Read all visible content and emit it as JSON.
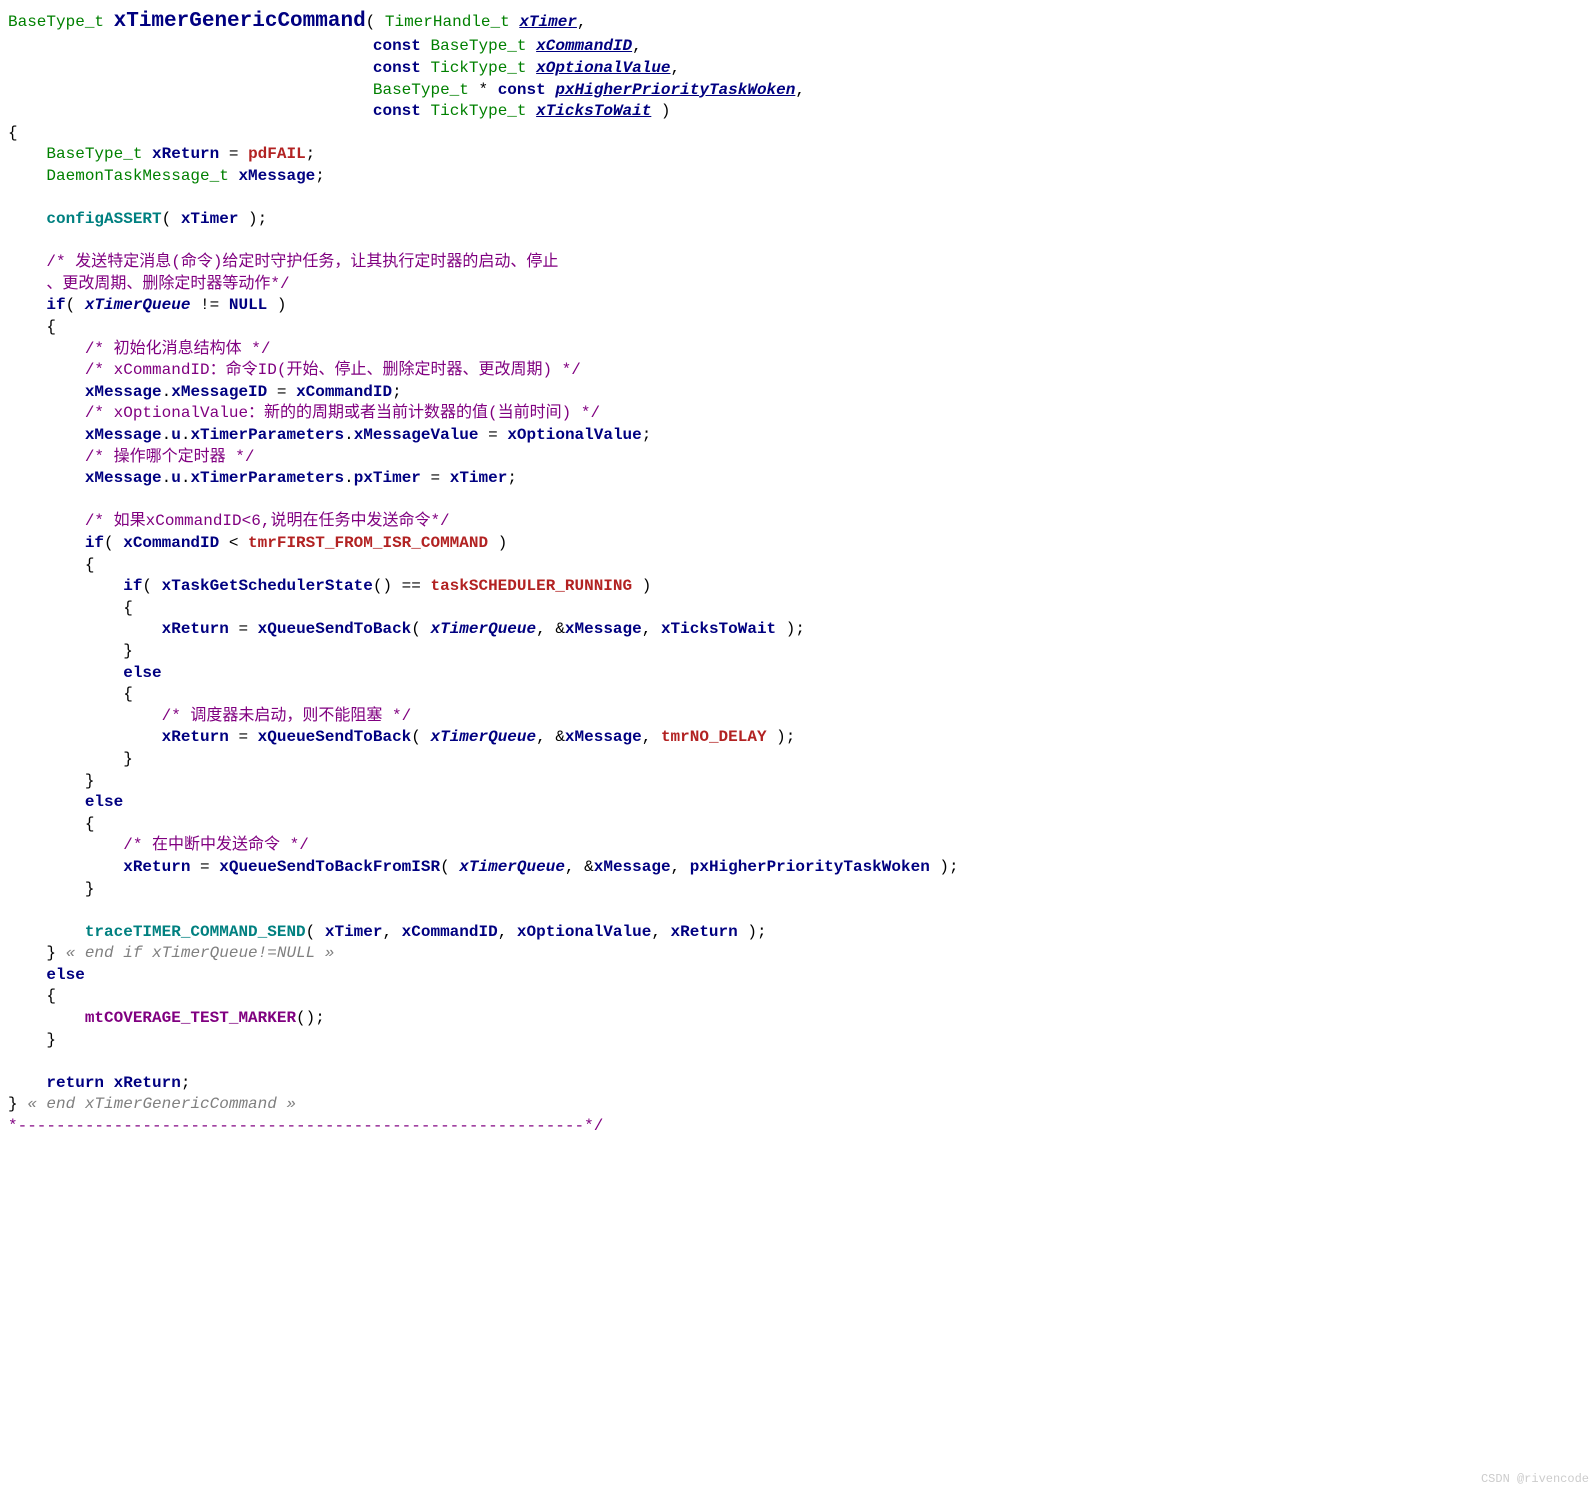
{
  "sig": {
    "ret": "BaseType_t",
    "name": "xTimerGenericCommand",
    "params": [
      {
        "type": "TimerHandle_t",
        "name": "xTimer"
      },
      {
        "type": "BaseType_t",
        "name": "xCommandID"
      },
      {
        "type": "TickType_t",
        "name": "xOptionalValue"
      },
      {
        "type": "BaseType_t",
        "name": "pxHigherPriorityTaskWoken"
      },
      {
        "type": "TickType_t",
        "name": "xTicksToWait"
      }
    ]
  },
  "kw": {
    "const": "const",
    "if": "if",
    "else": "else",
    "return": "return",
    "null": "NULL"
  },
  "body": {
    "l1": {
      "t": "BaseType_t",
      "v": "xReturn",
      "m": "pdFAIL"
    },
    "l2": {
      "t": "DaemonTaskMessage_t",
      "v": "xMessage"
    },
    "assert": "configASSERT"
  },
  "mem": {
    "xMessageID": "xMessageID",
    "u": "u",
    "xTimerParameters": "xTimerParameters",
    "xMessageValue": "xMessageValue",
    "pxTimer": "pxTimer"
  },
  "args": {
    "xTimer": "xTimer",
    "xCommandID": "xCommandID",
    "xOptionalValue": "xOptionalValue",
    "xTicksToWait": "xTicksToWait",
    "xTimerQueue": "xTimerQueue",
    "pxHigher": "pxHigherPriorityTaskWoken"
  },
  "mac": {
    "tmrFirst": "tmrFIRST_FROM_ISR_COMMAND",
    "schedRun": "taskSCHEDULER_RUNNING",
    "noDelay": "tmrNO_DELAY"
  },
  "calls": {
    "getSched": "xTaskGetSchedulerState",
    "sendBack": "xQueueSendToBack",
    "sendBackISR": "xQueueSendToBackFromISR",
    "trace": "traceTIMER_COMMAND_SEND",
    "mtcov": "mtCOVERAGE_TEST_MARKER"
  },
  "cm": {
    "c1a": "/* 发送特定消息(命令)给定时守护任务，让其执行定时器的启动、停止",
    "c1b": "、更改周期、删除定时器等动作*/",
    "c2": "/* 初始化消息结构体 */",
    "c3": "/* xCommandID：命令ID(开始、停止、删除定时器、更改周期) */",
    "c4": "/* xOptionalValue：新的的周期或者当前计数器的值(当前时间) */",
    "c5": "/* 操作哪个定时器 */",
    "c6": "/* 如果xCommandID<6,说明在任务中发送命令*/",
    "c7": "/* 调度器未启动，则不能阻塞 */",
    "c8": "/* 在中断中发送命令 */",
    "end1": "« end if xTimerQueue!=NULL »",
    "end2": "« end xTimerGenericCommand »",
    "dash": "*-----------------------------------------------------------*/"
  },
  "wm": "CSDN @rivencode"
}
